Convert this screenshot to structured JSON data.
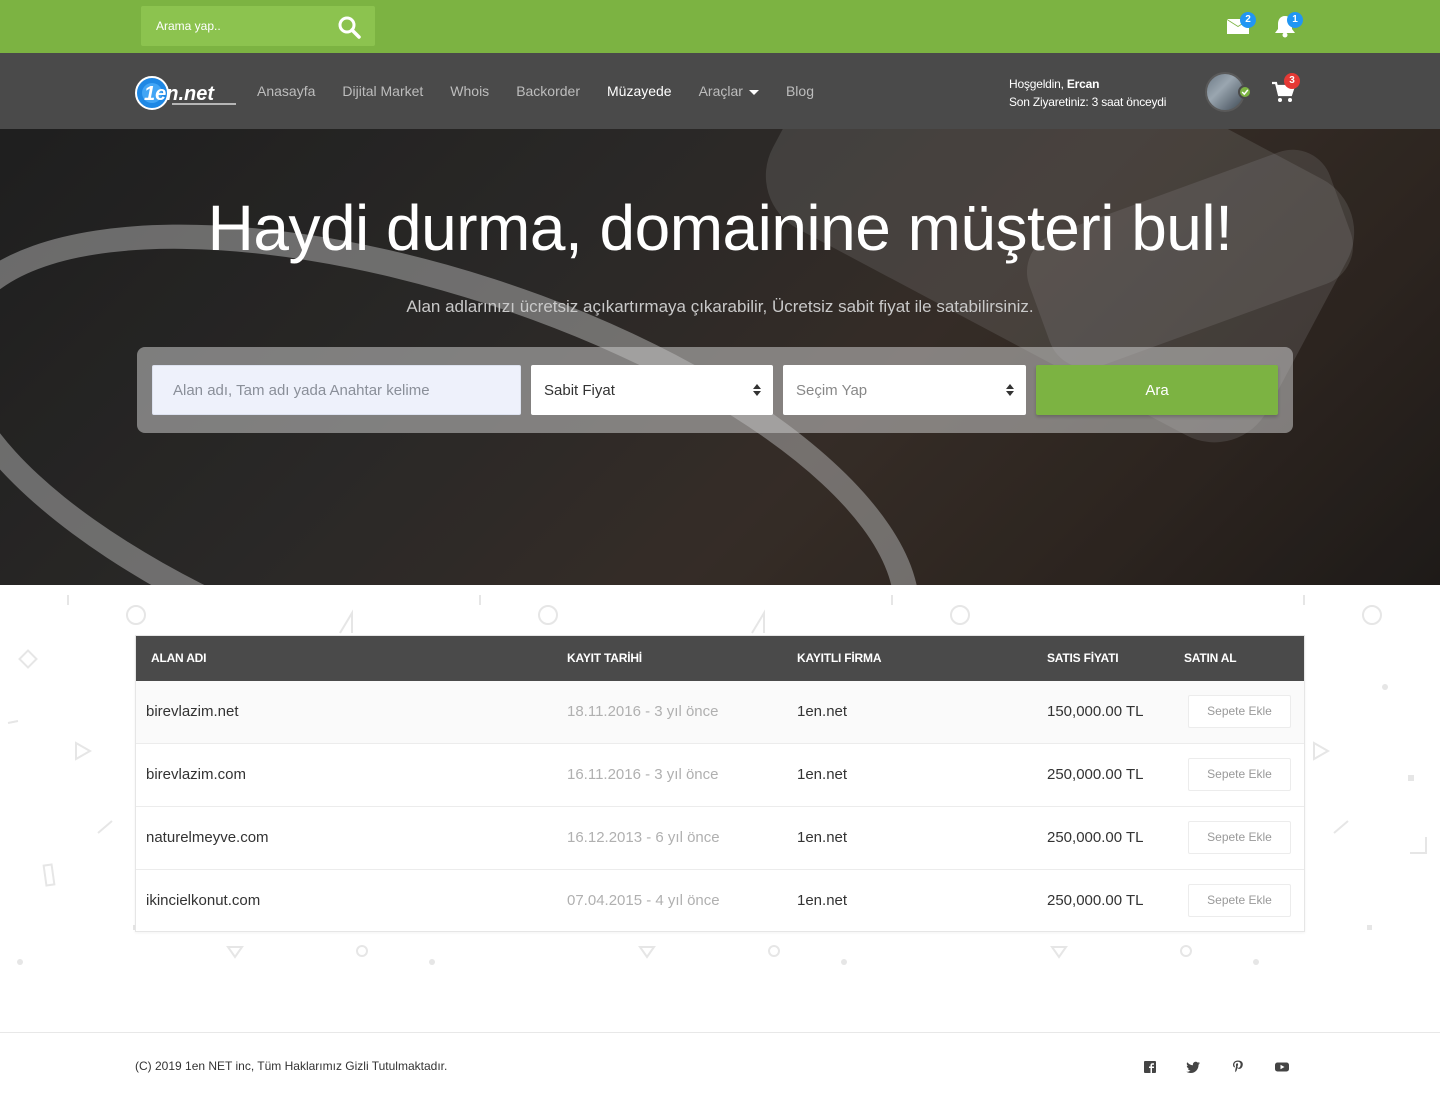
{
  "topbar": {
    "search_placeholder": "Arama yap..",
    "messages_count": "2",
    "notifications_count": "1"
  },
  "nav": {
    "links": [
      {
        "label": "Anasayfa"
      },
      {
        "label": "Dijital Market"
      },
      {
        "label": "Whois"
      },
      {
        "label": "Backorder"
      },
      {
        "label": "Müzayede"
      },
      {
        "label": "Araçlar"
      },
      {
        "label": "Blog"
      }
    ],
    "active_link": "Müzayede",
    "welcome_prefix": "Hoşgeldin,",
    "user_name": "Ercan",
    "last_visit": "Son Ziyaretiniz: 3 saat önceydi",
    "cart_count": "3"
  },
  "hero": {
    "title": "Haydi durma, domainine müşteri bul!",
    "subtitle": "Alan adlarınızı ücretsiz açıkartırmaya çıkarabilir, Ücretsiz sabit fiyat ile satabilirsiniz.",
    "search_placeholder": "Alan adı, Tam adı yada Anahtar kelime",
    "type_select": "Sabit Fiyat",
    "choice_select": "Seçim Yap",
    "search_button": "Ara"
  },
  "table": {
    "headers": [
      "ALAN ADI",
      "KAYIT TARİHİ",
      "KAYITLI FİRMA",
      "SATIS FİYATI",
      "SATIN AL"
    ],
    "rows": [
      {
        "domain": "birevlazim.net",
        "date": "18.11.2016 - 3 yıl önce",
        "firm": "1en.net",
        "price": "150,000.00 TL",
        "action": "Sepete Ekle"
      },
      {
        "domain": "birevlazim.com",
        "date": "16.11.2016 - 3 yıl önce",
        "firm": "1en.net",
        "price": "250,000.00 TL",
        "action": "Sepete Ekle"
      },
      {
        "domain": "naturelmeyve.com",
        "date": "16.12.2013 - 6 yıl önce",
        "firm": "1en.net",
        "price": "250,000.00 TL",
        "action": "Sepete Ekle"
      },
      {
        "domain": "ikincielkonut.com",
        "date": "07.04.2015 - 4 yıl önce",
        "firm": "1en.net",
        "price": "250,000.00 TL",
        "action": "Sepete Ekle"
      }
    ]
  },
  "footer": {
    "copyright": "(C) 2019 1en NET inc, Tüm Haklarımız Gizli Tutulmaktadır.",
    "social": [
      "facebook-icon",
      "twitter-icon",
      "pinterest-icon",
      "youtube-icon"
    ]
  },
  "colors": {
    "brand_green": "#7cb342",
    "nav_dark": "#4a4a4a",
    "badge_blue": "#2196f3",
    "badge_red": "#e53935"
  }
}
